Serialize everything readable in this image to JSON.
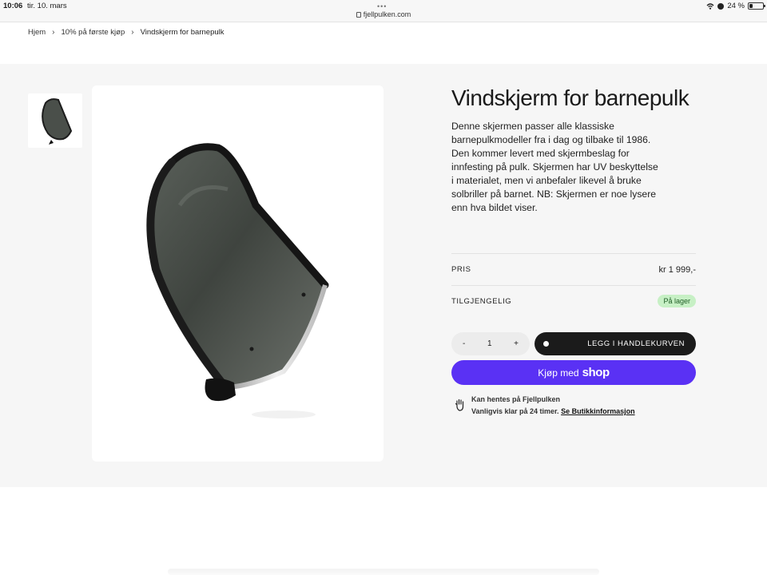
{
  "status_bar": {
    "time": "10:06",
    "date": "tir. 10. mars",
    "dots": "•••",
    "url": "fjellpulken.com",
    "battery": "24 %",
    "battery_level": 0.24
  },
  "breadcrumb": {
    "items": [
      "Hjem",
      "10% på første kjøp",
      "Vindskjerm for barnepulk"
    ],
    "separator": "›"
  },
  "product": {
    "title": "Vindskjerm for barnepulk",
    "description": "Denne skjermen passer alle klassiske barnepulkmodeller fra i dag og tilbake til 1986. Den kommer levert med skjermbeslag for innfesting på pulk. Skjermen har UV beskyttelse i materialet, men vi anbefaler likevel å bruke solbriller på barnet. NB: Skjermen er noe lysere enn hva bildet viser.",
    "price_label": "PRIS",
    "price_value": "kr 1 999,-",
    "availability_label": "TILGJENGELIG",
    "availability_value": "På lager",
    "quantity": {
      "minus": "-",
      "value": "1",
      "plus": "+"
    },
    "add_to_cart": "LEGG I HANDLEKURVEN",
    "shop_pay": {
      "prefix": "Kjøp med",
      "brand": "shop"
    },
    "pickup": {
      "title": "Kan hentes på Fjellpulken",
      "note": "Vanligvis klar på 24 timer.",
      "link": "Se Butikkinformasjon"
    }
  },
  "colors": {
    "shop_pay": "#5a31f4",
    "cart_button": "#1b1b1b",
    "stock_badge_bg": "#c7f0c5",
    "stock_badge_text": "#1f5d26",
    "section_bg": "#f6f6f6"
  },
  "icons": [
    "lock-icon",
    "wifi-icon",
    "alarm-icon",
    "battery-icon",
    "chevron-right-icon",
    "hand-icon"
  ]
}
